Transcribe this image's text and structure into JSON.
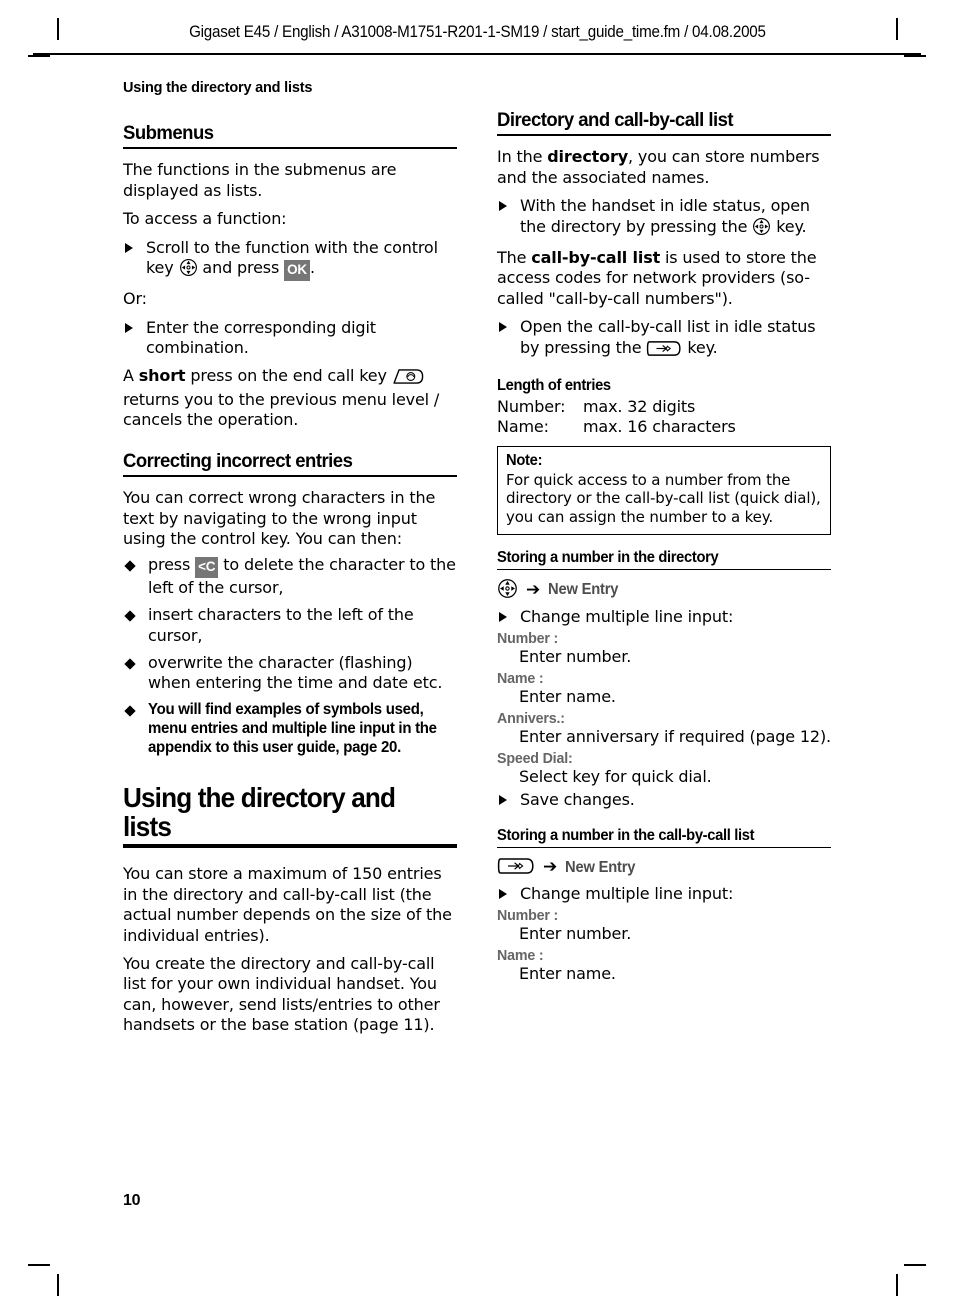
{
  "header": {
    "text": "Gigaset E45 / English / A31008-M1751-R201-1-SM19 / start_guide_time.fm / 04.08.2005"
  },
  "running_head": "Using the directory and lists",
  "folio": "10",
  "colors": {
    "key_badge_bg": "#767676",
    "key_badge_fg": "#ffffff",
    "field_label": "#666666",
    "menu_label": "#4d4d4d",
    "rule": "#000000"
  },
  "left_column": {
    "submenus": {
      "heading": "Submenus",
      "p1": "The functions in the submenus are displayed as lists.",
      "p2": "To access a function:",
      "step1_a": "Scroll to the function with the control key ",
      "step1_key_icon": "control-key-icon",
      "step1_b": " and press ",
      "step1_badge": "OK",
      "step1_c": ".",
      "or": "Or:",
      "step2": "Enter the corresponding digit combination.",
      "p3_a": "A ",
      "p3_bold": "short",
      "p3_b": " press on the end call key ",
      "p3_key_icon": "end-call-key-icon",
      "p3_c": " returns you to the previous menu level / cancels the operation."
    },
    "correcting": {
      "heading": "Correcting incorrect entries",
      "p1": "You can correct wrong characters in the text by navigating to the wrong input using the control key. You can then:",
      "bullets": [
        {
          "pre": "press ",
          "badge": "<C",
          "post": " to delete the character to the left of the cursor,",
          "bold": false
        },
        {
          "pre": "insert characters to the left of the cursor,",
          "badge": null,
          "post": "",
          "bold": false
        },
        {
          "pre": "overwrite the character (flashing) when entering the time and date etc.",
          "badge": null,
          "post": "",
          "bold": false
        },
        {
          "pre": "You will find examples of symbols used, menu entries and multiple line input in the appendix to this user guide, page 20.",
          "badge": null,
          "post": "",
          "bold": true
        }
      ]
    },
    "using_directory": {
      "heading": "Using the directory and lists",
      "p1": "You can store a maximum of 150 entries in the directory and call-by-call list (the actual number depends on the size of the individual entries).",
      "p2": "You create the directory and call-by-call list for your own individual handset. You can, however, send lists/entries to other handsets or the base station (page 11)."
    }
  },
  "right_column": {
    "directory_list": {
      "heading": "Directory and call-by-call list",
      "p1_a": "In the ",
      "p1_bold": "directory",
      "p1_b": ", you can store numbers and the associated names.",
      "step1_a": "With the handset in idle status, open the directory by pressing the ",
      "step1_key_icon": "control-key-icon",
      "step1_b": " key.",
      "p2_a": "The ",
      "p2_bold": "call-by-call list",
      "p2_b": " is used to store the access codes for network providers (so-called \"call-by-call numbers\").",
      "step2_a": "Open the call-by-call list in idle status by pressing the ",
      "step2_key_icon": "call-by-call-key-icon",
      "step2_b": " key."
    },
    "length_of_entries": {
      "heading": "Length of entries",
      "rows": [
        {
          "label": "Number:",
          "value": "max. 32 digits"
        },
        {
          "label": "Name:",
          "value": "max. 16 characters"
        }
      ]
    },
    "note": {
      "title": "Note:",
      "body": "For quick access to a number from the directory or the call-by-call list (quick dial), you can assign the number to a key."
    },
    "storing_directory": {
      "heading": "Storing a number in the directory",
      "path_icon": "control-key-icon",
      "path_arrow": "➔",
      "path_label": "New Entry",
      "step1": "Change multiple line input:",
      "fields": [
        {
          "label": "Number :",
          "value": "Enter number."
        },
        {
          "label": "Name :",
          "value": "Enter name."
        },
        {
          "label": "Annivers.:",
          "value": "Enter anniversary if required (page 12)."
        },
        {
          "label": "Speed Dial:",
          "value": "Select key for quick dial."
        }
      ],
      "step2": "Save changes."
    },
    "storing_cbc": {
      "heading": "Storing a number in the call-by-call list",
      "path_icon": "call-by-call-key-icon",
      "path_arrow": "➔",
      "path_label": "New Entry",
      "step1": "Change multiple line input:",
      "fields": [
        {
          "label": "Number :",
          "value": "Enter number."
        },
        {
          "label": "Name :",
          "value": "Enter name."
        }
      ]
    }
  }
}
